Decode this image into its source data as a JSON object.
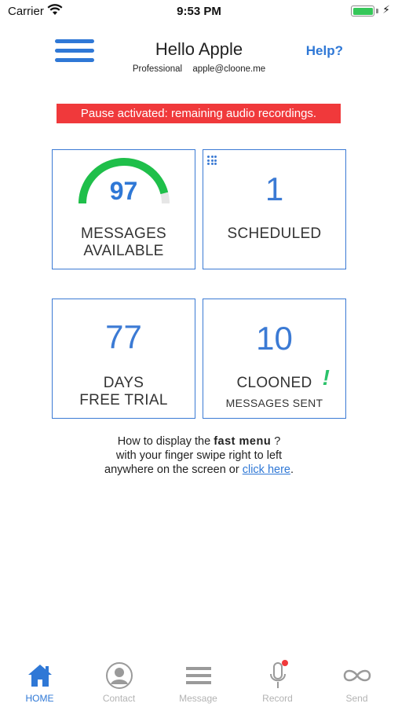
{
  "status_bar": {
    "carrier": "Carrier",
    "time": "9:53 PM",
    "bolt": "⚡"
  },
  "header": {
    "greeting": "Hello Apple",
    "plan": "Professional",
    "email": "apple@cloone.me",
    "help_label": "Help?"
  },
  "alert": {
    "text": "Pause activated: remaining audio recordings."
  },
  "cards": {
    "messages": {
      "value": "97",
      "caption_line1": "MESSAGES",
      "caption_line2": "AVAILABLE",
      "gauge_fraction": 0.92
    },
    "scheduled": {
      "value": "1",
      "caption": "SCHEDULED"
    },
    "trial": {
      "value": "77",
      "caption_line1": "DAYS",
      "caption_line2": "FREE TRIAL"
    },
    "sent": {
      "value": "10",
      "caption": "CLOONED",
      "exclamation": "!",
      "subcaption": "MESSAGES SENT"
    }
  },
  "hint": {
    "line1_pre": "How to display the ",
    "line1_bold": "fast menu",
    "line1_post": " ?",
    "line2": "with your finger swipe right to left",
    "line3_pre": "anywhere on the screen or ",
    "link": "click here",
    "line3_post": "."
  },
  "tabs": [
    {
      "label": "HOME",
      "icon": "home-icon",
      "active": true
    },
    {
      "label": "Contact",
      "icon": "contact-icon",
      "active": false
    },
    {
      "label": "Message",
      "icon": "message-icon",
      "active": false
    },
    {
      "label": "Record",
      "icon": "microphone-icon",
      "active": false
    },
    {
      "label": "Send",
      "icon": "infinity-icon",
      "active": false
    }
  ],
  "colors": {
    "accent": "#2f78d6",
    "alert": "#f0393b",
    "gauge": "#1fbf4a",
    "record_dot": "#f0393b"
  }
}
